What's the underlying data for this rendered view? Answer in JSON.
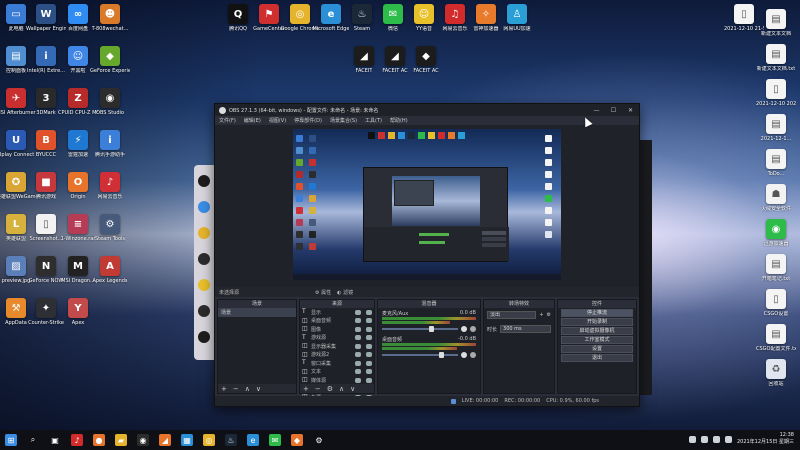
{
  "desktop": {
    "icons_left": [
      {
        "label": "此电脑",
        "color": "#3a7bd5",
        "glyph": "▭"
      },
      {
        "label": "Wallpaper Engine:...",
        "color": "#2c4f86",
        "glyph": "W"
      },
      {
        "label": "百度网盘",
        "color": "#2f8cf2",
        "glyph": "∞"
      },
      {
        "label": "T-808wechat...",
        "color": "#d97a2b",
        "glyph": "☻"
      },
      {
        "label": "控制面板",
        "color": "#4f8fd1",
        "glyph": "▤"
      },
      {
        "label": "Intel(R) Extre...",
        "color": "#3469b5",
        "glyph": "i"
      },
      {
        "label": "开黑啦",
        "color": "#3f86e6",
        "glyph": "☺"
      },
      {
        "label": "GeForce Experience",
        "color": "#66a82b",
        "glyph": "◆"
      },
      {
        "label": "MSI Afterburner",
        "color": "#c92f2f",
        "glyph": "✈"
      },
      {
        "label": "3DMark",
        "color": "#2a2a2a",
        "glyph": "3"
      },
      {
        "label": "CPUID CPU-Z MSI",
        "color": "#b62a2a",
        "glyph": "Z"
      },
      {
        "label": "OBS Studio",
        "color": "#2c2c2c",
        "glyph": "◉"
      },
      {
        "label": "Uplay Connect",
        "color": "#2a5ab3",
        "glyph": "U"
      },
      {
        "label": "BYUCCC",
        "color": "#e0532a",
        "glyph": "B"
      },
      {
        "label": "雷霆加速",
        "color": "#1f78d1",
        "glyph": "⚡"
      },
      {
        "label": "腾讯手游助手",
        "color": "#3c7fd8",
        "glyph": "i"
      },
      {
        "label": "英雄联盟WeGame",
        "color": "#d9a534",
        "glyph": "✪"
      },
      {
        "label": "腾讯游戏",
        "color": "#c6383c",
        "glyph": "■"
      },
      {
        "label": "Origin",
        "color": "#e8742b",
        "glyph": "O"
      },
      {
        "label": "网易云音乐",
        "color": "#cf2f35",
        "glyph": "♪"
      },
      {
        "label": "英雄联盟",
        "color": "#d6b23c",
        "glyph": "L"
      },
      {
        "label": "Screenshot...",
        "color": "#f2f2f2",
        "glyph": "▯"
      },
      {
        "label": "1-Winzone.rar",
        "color": "#b63c56",
        "glyph": "≡"
      },
      {
        "label": "Steam Tools",
        "color": "#465a7c",
        "glyph": "⚙"
      },
      {
        "label": "preview.jpg",
        "color": "#5b7fb8",
        "glyph": "▨"
      },
      {
        "label": "GeForce NOW",
        "color": "#2e2e2e",
        "glyph": "N"
      },
      {
        "label": "MSI Dragon...",
        "color": "#222",
        "glyph": "M"
      },
      {
        "label": "Apex Legends",
        "color": "#c23a34",
        "glyph": "A"
      },
      {
        "label": "AppData",
        "color": "#e88a2c",
        "glyph": "⚒"
      },
      {
        "label": "Counter-Strike",
        "color": "#2d2f35",
        "glyph": "✦"
      },
      {
        "label": "Apex",
        "color": "#c34a4a",
        "glyph": "Y"
      }
    ],
    "icons_top": [
      {
        "label": "腾讯QQ",
        "color": "#111",
        "glyph": "Q"
      },
      {
        "label": "GameCenter",
        "color": "#d02f2f",
        "glyph": "⚑"
      },
      {
        "label": "Google Chrome",
        "color": "#e6b42c",
        "glyph": "◎"
      },
      {
        "label": "Microsoft Edge",
        "color": "#2a8fd6",
        "glyph": "e"
      },
      {
        "label": "Steam",
        "color": "#1b2838",
        "glyph": "♨"
      },
      {
        "label": "微信",
        "color": "#2dbb4a",
        "glyph": "✉"
      },
      {
        "label": "YY语音",
        "color": "#e8c02a",
        "glyph": "☺"
      },
      {
        "label": "网易云音乐",
        "color": "#d12b2b",
        "glyph": "♫"
      },
      {
        "label": "雷神加速器",
        "color": "#e87a2c",
        "glyph": "✧"
      },
      {
        "label": "网易UU加速",
        "color": "#2a9fd6",
        "glyph": "♙"
      }
    ],
    "icons_faceit": [
      {
        "label": "FACEIT",
        "color": "#1c1c1c",
        "glyph": "◢"
      },
      {
        "label": "FACEIT AC",
        "color": "#1c1c1c",
        "glyph": "◢"
      },
      {
        "label": "FACEIT AC",
        "color": "#1c1c1c",
        "glyph": "◆"
      }
    ],
    "icons_right": [
      {
        "label": "2021-12-10 21-52-17...",
        "color": "#f4f4f4",
        "glyph": "▯"
      },
      {
        "label": "新建文本文档",
        "color": "#f4f4f4",
        "glyph": "▤"
      },
      {
        "label": "新建文本文档.txt",
        "color": "#f4f4f4",
        "glyph": "▤"
      },
      {
        "label": "2021-12-10 20211025...",
        "color": "#f4f4f4",
        "glyph": "▯"
      },
      {
        "label": "2021-12-1...",
        "color": "#f4f4f4",
        "glyph": "▤"
      },
      {
        "label": "ToDo...",
        "color": "#f4f4f4",
        "glyph": "▤"
      },
      {
        "label": "火绒安全软件",
        "color": "#f2f2f2",
        "glyph": "☗"
      },
      {
        "label": "迅游加速器",
        "color": "#2dbb4a",
        "glyph": "◉"
      },
      {
        "label": "开箱笔记.txt",
        "color": "#f4f4f4",
        "glyph": "▤"
      },
      {
        "label": "CSGO设置",
        "color": "#f4f4f4",
        "glyph": "▯"
      },
      {
        "label": "CSGO配置文件.txt",
        "color": "#f4f4f4",
        "glyph": "▤"
      },
      {
        "label": "回收站",
        "color": "#dfe6ef",
        "glyph": "♻"
      }
    ]
  },
  "obs": {
    "title": "OBS 27.1.3 (64-bit, windows) - 配置文件: 未命名 - 场景: 未命名",
    "menu": [
      "文件(F)",
      "编辑(E)",
      "视图(V)",
      "停靠部件(D)",
      "场景集合(S)",
      "工具(T)",
      "帮助(H)"
    ],
    "source_bar": {
      "no_source": "未选择源",
      "properties": "属性",
      "filters": "滤镜"
    },
    "docks": {
      "scenes": {
        "title": "场景",
        "items": [
          "场景"
        ]
      },
      "sources": {
        "title": "来源",
        "items": [
          "显示",
          "桌面音频",
          "图像",
          "游戏源",
          "显示器采集",
          "游戏源2",
          "窗口采集",
          "文本",
          "媒体源",
          "浏览器",
          "色源"
        ]
      },
      "mixer": {
        "title": "混音器",
        "tracks": [
          {
            "name": "麦克风/Aux",
            "db": "0.0 dB"
          },
          {
            "name": "桌面音频",
            "db": "-0.0 dB"
          }
        ]
      },
      "transitions": {
        "title": "转场特效",
        "fade": "淡出",
        "duration_label": "时长",
        "duration": "300 ms"
      },
      "controls": {
        "title": "控件",
        "buttons": [
          "停止推流",
          "开始录制",
          "启动虚拟摄像机",
          "工作室模式",
          "设置",
          "退出"
        ]
      }
    },
    "status": {
      "live": "LIVE: 00:00:00",
      "rec": "REC: 00:00:00",
      "cpu": "CPU: 0.9%, 60.00 fps"
    }
  },
  "taskbar": {
    "time": "12:38",
    "date": "2021年12月15日 星期三",
    "items": [
      {
        "name": "start",
        "color": "#3a8ee6",
        "glyph": "⊞"
      },
      {
        "name": "search",
        "color": "#0e1016",
        "glyph": "⌕"
      },
      {
        "name": "task-view",
        "color": "#0e1016",
        "glyph": "▣"
      },
      {
        "name": "netease",
        "color": "#d12b2b",
        "glyph": "♪"
      },
      {
        "name": "firefox",
        "color": "#e8742b",
        "glyph": "●"
      },
      {
        "name": "explorer",
        "color": "#e6b42c",
        "glyph": "▰"
      },
      {
        "name": "obs",
        "color": "#2c2c2c",
        "glyph": "◉"
      },
      {
        "name": "faceit",
        "color": "#e8742b",
        "glyph": "◢"
      },
      {
        "name": "store",
        "color": "#2a8fd6",
        "glyph": "▦"
      },
      {
        "name": "chrome",
        "color": "#e6b42c",
        "glyph": "◎"
      },
      {
        "name": "steam",
        "color": "#1b2838",
        "glyph": "♨"
      },
      {
        "name": "edge",
        "color": "#2a8fd6",
        "glyph": "e"
      },
      {
        "name": "wechat",
        "color": "#2dbb4a",
        "glyph": "✉"
      },
      {
        "name": "faceit-ac",
        "color": "#e8742b",
        "glyph": "◆"
      },
      {
        "name": "settings",
        "color": "#0e1016",
        "glyph": "⚙"
      }
    ]
  }
}
